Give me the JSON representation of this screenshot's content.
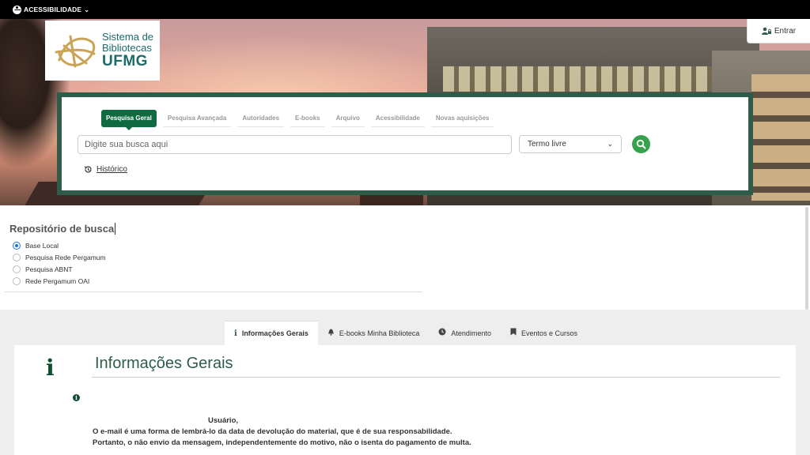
{
  "topbar": {
    "accessibility_label": "ACESSIBILIDADE"
  },
  "logo": {
    "line1": "Sistema de",
    "line2": "Bibliotecas",
    "line3": "UFMG"
  },
  "login": {
    "label": "Entrar"
  },
  "search": {
    "tabs": [
      {
        "label": "Pesquisa Geral",
        "active": true
      },
      {
        "label": "Pesquisa Avançada"
      },
      {
        "label": "Autoridades"
      },
      {
        "label": "E-books"
      },
      {
        "label": "Arquivo"
      },
      {
        "label": "Acessibilidade"
      },
      {
        "label": "Novas aquisições"
      }
    ],
    "placeholder": "Digite sua busca aqui",
    "select_value": "Termo livre",
    "history_label": "Histórico"
  },
  "repository": {
    "title": "Repositório de busca",
    "options": [
      {
        "label": "Base Local",
        "checked": true
      },
      {
        "label": "Pesquisa Rede Pergamum"
      },
      {
        "label": "Pesquisa ABNT"
      },
      {
        "label": "Rede Pergamum OAI"
      }
    ]
  },
  "info_tabs": [
    {
      "label": "Informações Gerais",
      "icon": "info-icon",
      "active": true
    },
    {
      "label": "E-books Minha Biblioteca",
      "icon": "bell-icon"
    },
    {
      "label": "Atendimento",
      "icon": "clock-icon"
    },
    {
      "label": "Eventos e Cursos",
      "icon": "bookmark-icon"
    }
  ],
  "content": {
    "title": "Informações Gerais",
    "greeting": "Usuário,",
    "line1": "O e-mail é uma forma de lembrá-lo da data de devolução do material, que é de sua responsabilidade.",
    "line2": "Portanto, o não envio da mensagem, independentemente do motivo, não o isenta do pagamento de multa."
  },
  "colors": {
    "brand_green": "#0f6b3f",
    "panel_border": "#2f5c48",
    "search_button": "#36a24c",
    "logo_teal": "#1d6a6b"
  }
}
